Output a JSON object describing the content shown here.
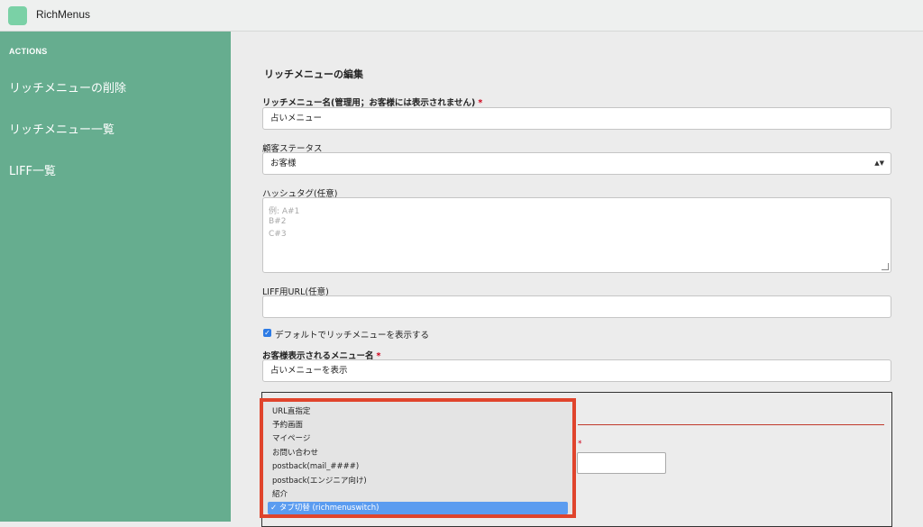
{
  "app": {
    "title": "RichMenus"
  },
  "sidebar": {
    "heading": "ACTIONS",
    "items": [
      {
        "label": "リッチメニューの削除"
      },
      {
        "label": "リッチメニュー一覧"
      },
      {
        "label": "LIFF一覧"
      }
    ]
  },
  "form": {
    "section_title": "リッチメニューの編集",
    "name": {
      "label": "リッチメニュー名(管理用；お客様には表示されません)",
      "required": "*",
      "value": "占いメニュー"
    },
    "status": {
      "label": "顧客ステータス",
      "value": "お客様",
      "arrow": "▲▼"
    },
    "hashtag": {
      "label": "ハッシュタグ(任意)",
      "placeholder_lines": [
        "例: A#1",
        "B#2",
        "C#3"
      ]
    },
    "liff_url": {
      "label": "LIFF用URL(任意)",
      "value": ""
    },
    "default_checkbox": {
      "label": "デフォルトでリッチメニューを表示する",
      "checked": true,
      "mark": "✓"
    },
    "display_name": {
      "label": "お客様表示されるメニュー名",
      "required": "*",
      "value": "占いメニューを表示"
    }
  },
  "panel": {
    "required": "*"
  },
  "dropdown": {
    "check_mark": "✓",
    "options": [
      {
        "label": "URL直指定"
      },
      {
        "label": "予約画面"
      },
      {
        "label": "マイページ"
      },
      {
        "label": "お問い合わせ"
      },
      {
        "label": "postback(mail_####)"
      },
      {
        "label": "postback(エンジニア向け)"
      },
      {
        "label": "紹介"
      },
      {
        "label": "タブ切替 (richmenuswitch)",
        "selected": true
      }
    ]
  }
}
